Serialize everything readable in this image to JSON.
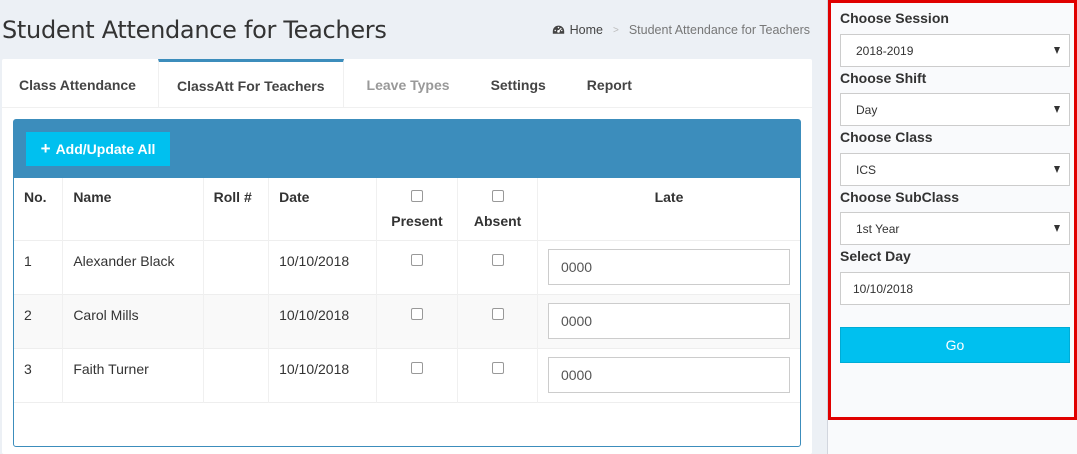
{
  "page": {
    "title": "Student Attendance for Teachers"
  },
  "breadcrumb": {
    "home_icon": "dashboard-gauge-icon",
    "home": "Home",
    "separator": ">",
    "current": "Student Attendance for Teachers"
  },
  "tabs": [
    {
      "label": "Class Attendance"
    },
    {
      "label": "ClassAtt For Teachers"
    },
    {
      "label": "Leave Types"
    },
    {
      "label": "Settings"
    },
    {
      "label": "Report"
    }
  ],
  "box": {
    "add_button_icon": "plus-icon",
    "add_button_label": "Add/Update All"
  },
  "table": {
    "headers": {
      "no": "No.",
      "name": "Name",
      "roll": "Roll #",
      "date": "Date",
      "present": "Present",
      "absent": "Absent",
      "late": "Late"
    },
    "rows": [
      {
        "no": "1",
        "name": "Alexander Black",
        "roll": "",
        "date": "10/10/2018",
        "late": "0000"
      },
      {
        "no": "2",
        "name": "Carol Mills",
        "roll": "",
        "date": "10/10/2018",
        "late": "0000"
      },
      {
        "no": "3",
        "name": "Faith Turner",
        "roll": "",
        "date": "10/10/2018",
        "late": "0000"
      }
    ]
  },
  "sidebar": {
    "session_label": "Choose Session",
    "session_value": "2018-2019",
    "shift_label": "Choose Shift",
    "shift_value": "Day",
    "class_label": "Choose Class",
    "class_value": "ICS",
    "subclass_label": "Choose SubClass",
    "subclass_value": "1st Year",
    "day_label": "Select Day",
    "day_value": "10/10/2018",
    "go_label": "Go"
  },
  "colors": {
    "primary": "#3c8dbc",
    "info": "#00c0ef",
    "highlight_frame": "#e00000"
  }
}
